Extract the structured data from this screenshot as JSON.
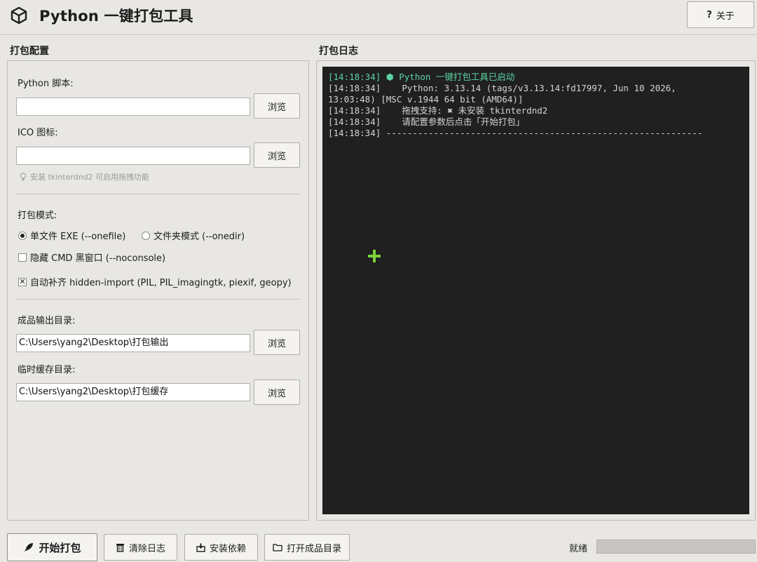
{
  "window": {
    "title": "Python 一键打包工具",
    "about_label": "关于",
    "about_icon": "question-icon"
  },
  "config": {
    "section_title": "打包配置",
    "script_label": "Python 脚本:",
    "script_value": "",
    "icon_label": "ICO 图标:",
    "icon_value": "",
    "browse_label": "浏览",
    "hint": "安装 tkinterdnd2 可启用拖拽功能",
    "mode_label": "打包模式:",
    "mode_onefile": "单文件 EXE (--onefile)",
    "mode_onedir": "文件夹模式 (--onedir)",
    "mode_selected": "onefile",
    "noconsole_label": "隐藏 CMD 黑窗口 (--noconsole)",
    "noconsole_checked": false,
    "hidden_import_label": "自动补齐 hidden-import (PIL, PIL_imagingtk, piexif, geopy)",
    "hidden_import_checked": true,
    "output_label": "成品输出目录:",
    "output_value": "C:\\Users\\yang2\\Desktop\\打包输出",
    "temp_label": "临时缓存目录:",
    "temp_value": "C:\\Users\\yang2\\Desktop\\打包缓存"
  },
  "log": {
    "section_title": "打包日志",
    "lines": [
      {
        "text": "[14:18:34] ⬢ Python 一键打包工具已启动",
        "color": "green"
      },
      {
        "text": "[14:18:34]    Python: 3.13.14 (tags/v3.13.14:fd17997, Jun 10 2026,",
        "color": "normal"
      },
      {
        "text": "13:03:48) [MSC v.1944 64 bit (AMD64)]",
        "color": "normal"
      },
      {
        "text": "[14:18:34]    拖拽支持: ✖ 未安装 tkinterdnd2",
        "color": "normal"
      },
      {
        "text": "[14:18:34]    请配置参数后点击「开始打包」",
        "color": "normal"
      },
      {
        "text": "[14:18:34] ------------------------------------------------------------",
        "color": "normal"
      }
    ]
  },
  "bottom": {
    "start_label": "开始打包",
    "clear_label": "清除日志",
    "deps_label": "安装依赖",
    "open_label": "打开成品目录",
    "status": "就绪",
    "progress": 0
  },
  "colors": {
    "background": "#e8e7e3",
    "log_bg": "#1f201f",
    "log_green": "#5fd1a6",
    "cursor": "#7ad03a"
  }
}
